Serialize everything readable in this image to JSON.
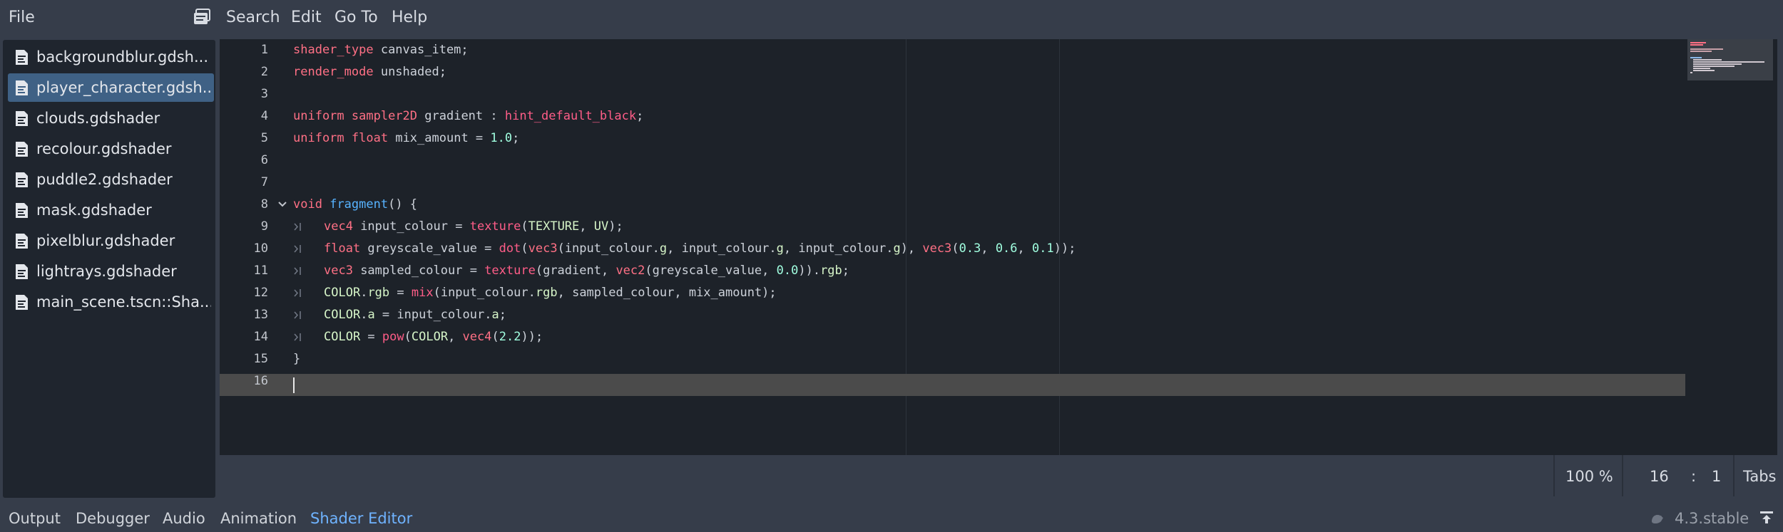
{
  "menu": {
    "file": "File",
    "search": "Search",
    "edit": "Edit",
    "go_to": "Go To",
    "help": "Help"
  },
  "files": [
    {
      "name": "backgroundblur.gdsh...",
      "selected": false
    },
    {
      "name": "player_character.gdsh...",
      "selected": true
    },
    {
      "name": "clouds.gdshader",
      "selected": false
    },
    {
      "name": "recolour.gdshader",
      "selected": false
    },
    {
      "name": "puddle2.gdshader",
      "selected": false
    },
    {
      "name": "mask.gdshader",
      "selected": false
    },
    {
      "name": "pixelblur.gdshader",
      "selected": false
    },
    {
      "name": "lightrays.gdshader",
      "selected": false
    },
    {
      "name": "main_scene.tscn::Sha...",
      "selected": false
    }
  ],
  "editor": {
    "line_numbers": [
      "1",
      "2",
      "3",
      "4",
      "5",
      "6",
      "7",
      "8",
      "9",
      "10",
      "11",
      "12",
      "13",
      "14",
      "15",
      "16"
    ],
    "lines": [
      "shader_type canvas_item;",
      "render_mode unshaded;",
      "",
      "uniform sampler2D gradient : hint_default_black;",
      "uniform float mix_amount = 1.0;",
      "",
      "",
      "void fragment() {",
      "\tvec4 input_colour = texture(TEXTURE, UV);",
      "\tfloat greyscale_value = dot(vec3(input_colour.g, input_colour.g, input_colour.g), vec3(0.3, 0.6, 0.1));",
      "\tvec3 sampled_colour = texture(gradient, vec2(greyscale_value, 0.0)).rgb;",
      "\tCOLOR.rgb = mix(input_colour.rgb, sampled_colour, mix_amount);",
      "\tCOLOR.a = input_colour.a;",
      "\tCOLOR = pow(COLOR, vec4(2.2));",
      "}",
      ""
    ],
    "current_line": 16
  },
  "status": {
    "zoom": "100 %",
    "line": "16",
    "separator": ":",
    "column": "1",
    "indent": "Tabs"
  },
  "bottom_tabs": [
    {
      "label": "Output",
      "active": false
    },
    {
      "label": "Debugger",
      "active": false
    },
    {
      "label": "Audio",
      "active": false
    },
    {
      "label": "Animation",
      "active": false
    },
    {
      "label": "Shader Editor",
      "active": true
    }
  ],
  "version": "4.3.stable",
  "colors": {
    "keyword": "#ff7085",
    "function": "#57b3ff",
    "number": "#a1ffe0",
    "selected_file": "#3f6185",
    "active_tab": "#6fb3ff"
  },
  "icons": {
    "scripts_panel": "scripts-panel-toggle-icon",
    "file": "text-file-icon",
    "fold": "chevron-down-icon",
    "tab": "tab-indent-icon",
    "update_spinner": "update-spinner-icon",
    "pin_panel": "pin-panel-icon"
  }
}
